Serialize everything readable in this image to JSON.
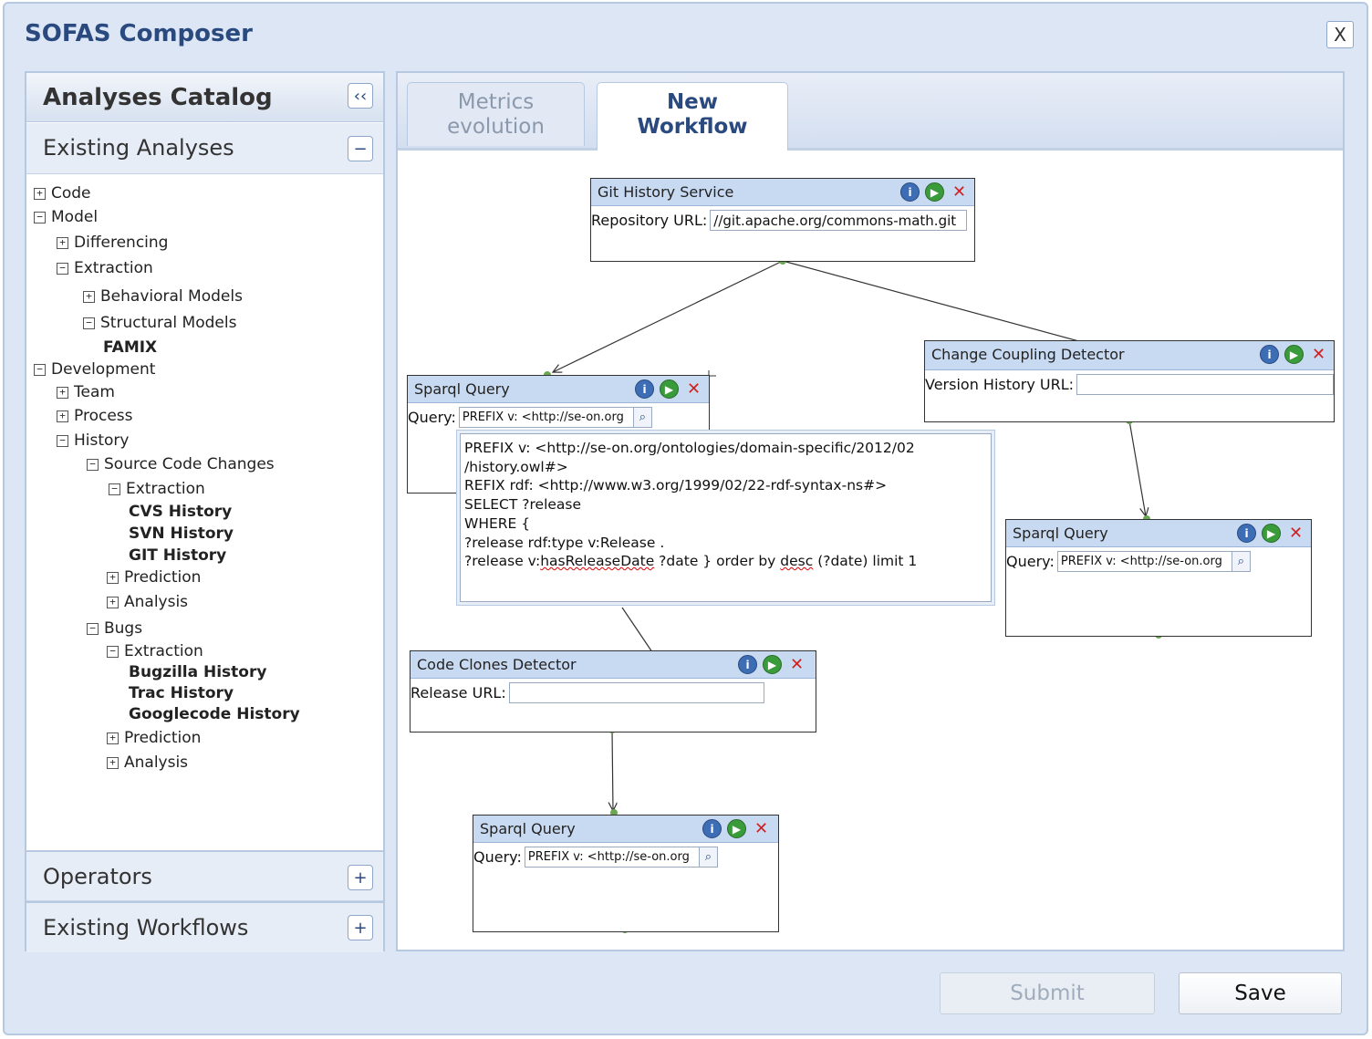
{
  "app": {
    "title": "SOFAS Composer",
    "close_label": "X"
  },
  "sidebar": {
    "catalog_title": "Analyses Catalog",
    "collapse_label": "‹‹",
    "existing_analyses": {
      "title": "Existing Analyses",
      "toggle": "−"
    },
    "tree": [
      {
        "label": "Code",
        "toggle": "+"
      },
      {
        "label": "Model",
        "toggle": "−"
      },
      {
        "label": "Differencing",
        "toggle": "+"
      },
      {
        "label": "Extraction",
        "toggle": "−"
      },
      {
        "label": "Behavioral Models",
        "toggle": "+"
      },
      {
        "label": "Structural Models",
        "toggle": "−"
      },
      {
        "label": "FAMIX",
        "toggle": ""
      },
      {
        "label": "Development",
        "toggle": "−"
      },
      {
        "label": "Team",
        "toggle": "+"
      },
      {
        "label": "Process",
        "toggle": "+"
      },
      {
        "label": "History",
        "toggle": "−"
      },
      {
        "label": "Source Code Changes",
        "toggle": "−"
      },
      {
        "label": "Extraction",
        "toggle": "−"
      },
      {
        "label": "CVS History",
        "toggle": ""
      },
      {
        "label": "SVN History",
        "toggle": ""
      },
      {
        "label": "GIT History",
        "toggle": ""
      },
      {
        "label": "Prediction",
        "toggle": "+"
      },
      {
        "label": "Analysis",
        "toggle": "+"
      },
      {
        "label": "Bugs",
        "toggle": "−"
      },
      {
        "label": "Extraction",
        "toggle": "−"
      },
      {
        "label": "Bugzilla History",
        "toggle": ""
      },
      {
        "label": "Trac History",
        "toggle": ""
      },
      {
        "label": "Googlecode History",
        "toggle": ""
      },
      {
        "label": "Prediction",
        "toggle": "+"
      },
      {
        "label": "Analysis",
        "toggle": "+"
      }
    ],
    "operators": {
      "title": "Operators",
      "toggle": "+"
    },
    "existing_workflows": {
      "title": "Existing Workflows",
      "toggle": "+"
    }
  },
  "tabs": [
    {
      "line1": "Metrics",
      "line2": "evolution"
    },
    {
      "line1": "New",
      "line2": "Workflow"
    }
  ],
  "nodes": {
    "git": {
      "title": "Git History Service",
      "field_label": "Repository URL:",
      "field_value": "//git.apache.org/commons-math.git"
    },
    "sparql1": {
      "title": "Sparql Query",
      "field_label": "Query:",
      "field_value": "PREFIX v:  <http://se-on.org"
    },
    "change_coupling": {
      "title": "Change Coupling Detector",
      "field_label": "Version History URL:",
      "field_value": ""
    },
    "sparql2": {
      "title": "Sparql Query",
      "field_label": "Query:",
      "field_value": "PREFIX v:  <http://se-on.org"
    },
    "code_clones": {
      "title": "Code Clones Detector",
      "field_label": "Release URL:",
      "field_value": ""
    },
    "sparql3": {
      "title": "Sparql Query",
      "field_label": "Query:",
      "field_value": "PREFIX v:  <http://se-on.org"
    }
  },
  "icons": {
    "info": "i",
    "run": "▶",
    "delete": "✕",
    "search": "⌕"
  },
  "query_popup": {
    "line1": "PREFIX v: <http://se-on.org/ontologies/domain-specific/2012/02",
    "line2": "/history.owl#>",
    "line3": "REFIX rdf: <http://www.w3.org/1999/02/22-rdf-syntax-ns#>",
    "line4": "SELECT ?release",
    "line5": "WHERE {",
    "line6": "?release rdf:type v:Release .",
    "line7a": "?release v:",
    "line7b": "hasReleaseDate",
    "line7c": " ?date } order by ",
    "line7d": "desc",
    "line7e": " (?date) limit 1"
  },
  "buttons": {
    "submit": "Submit",
    "save": "Save"
  },
  "colors": {
    "accent": "#2a4a7f",
    "node_header": "#c8daf2",
    "connector": "#6aa84f"
  }
}
